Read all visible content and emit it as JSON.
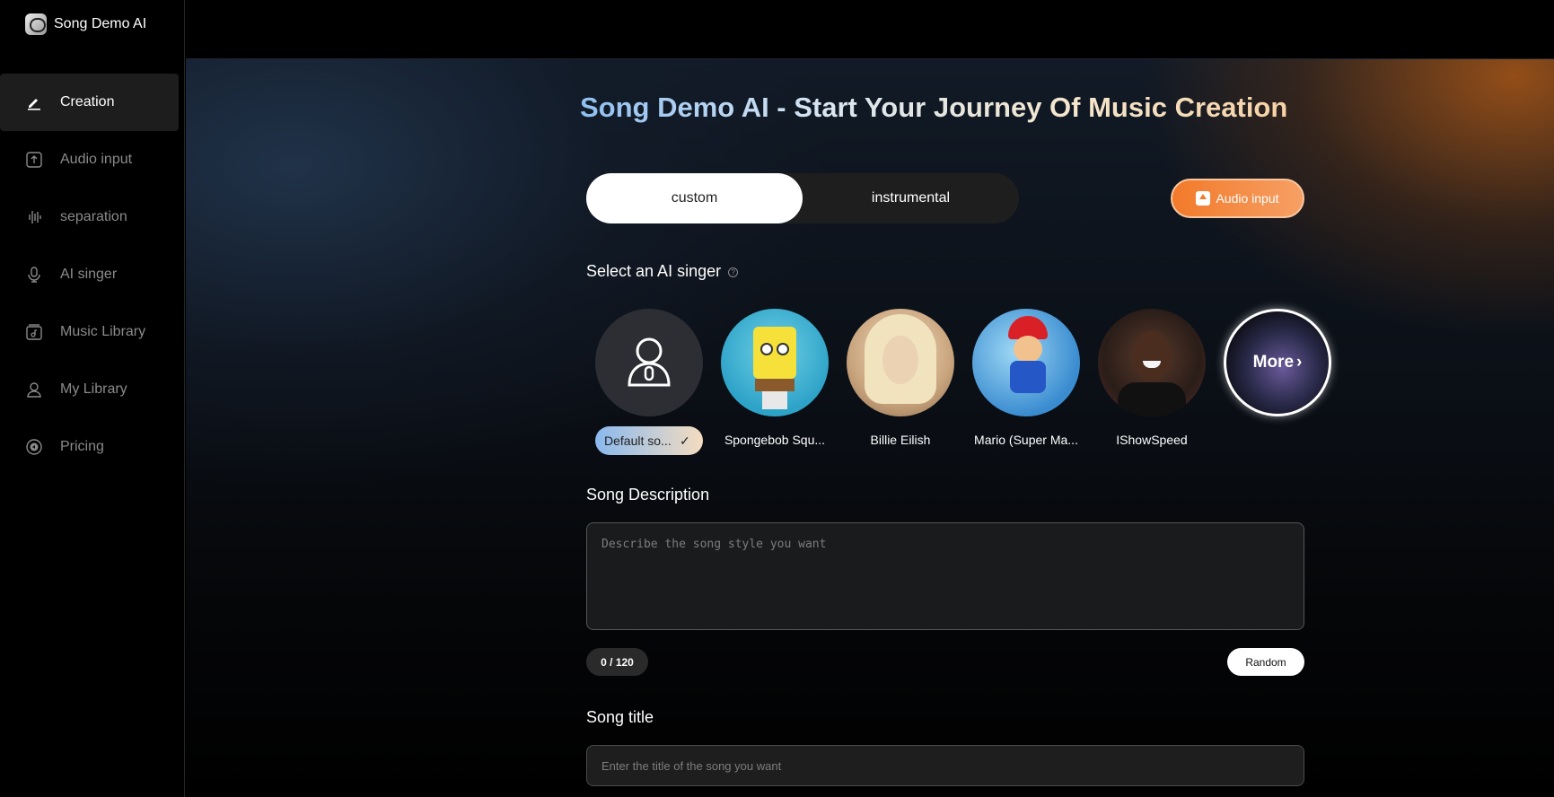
{
  "app": {
    "name": "Song Demo AI"
  },
  "sidebar": {
    "items": [
      {
        "label": "Creation",
        "icon": "pencil-icon",
        "active": true
      },
      {
        "label": "Audio input",
        "icon": "upload-icon"
      },
      {
        "label": "separation",
        "icon": "waveform-icon"
      },
      {
        "label": "AI singer",
        "icon": "microphone-icon"
      },
      {
        "label": "Music Library",
        "icon": "music-folder-icon"
      },
      {
        "label": "My Library",
        "icon": "user-icon"
      },
      {
        "label": "Pricing",
        "icon": "pricing-icon"
      }
    ]
  },
  "main": {
    "title": "Song Demo AI - Start Your Journey Of Music Creation",
    "tabs": [
      {
        "label": "custom",
        "active": true
      },
      {
        "label": "instrumental",
        "active": false
      }
    ],
    "audio_input_button": "Audio input",
    "singer_section": {
      "label": "Select an AI singer",
      "info": "?"
    },
    "singers": [
      {
        "name": "Default so...",
        "selected": true
      },
      {
        "name": "Spongebob Squ..."
      },
      {
        "name": "Billie Eilish"
      },
      {
        "name": "Mario (Super Ma..."
      },
      {
        "name": "IShowSpeed"
      }
    ],
    "more_label": "More",
    "description": {
      "label": "Song Description",
      "placeholder": "Describe the song style you want",
      "counter": "0 / 120",
      "random_button": "Random"
    },
    "song_title": {
      "label": "Song title",
      "placeholder": "Enter the title of the song you want"
    }
  },
  "colors": {
    "accent_orange": "#f27a2a",
    "title_gradient_start": "#8fbff2",
    "title_gradient_end": "#f6d2a6"
  }
}
